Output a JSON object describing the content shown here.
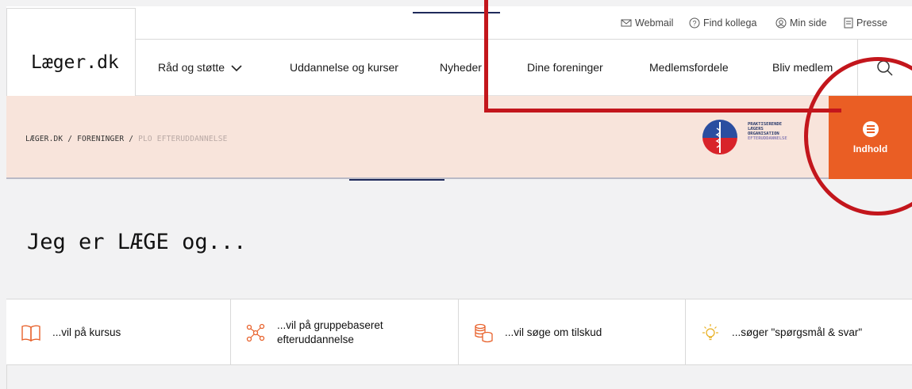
{
  "header": {
    "logo": "Læger.dk",
    "utility": [
      {
        "label": "Webmail",
        "icon": "mail-icon"
      },
      {
        "label": "Find kollega",
        "icon": "question-circle-icon"
      },
      {
        "label": "Min side",
        "icon": "user-circle-icon"
      },
      {
        "label": "Presse",
        "icon": "document-icon"
      }
    ],
    "nav": [
      {
        "label": "Råd og støtte"
      },
      {
        "label": "Uddannelse og kurser"
      },
      {
        "label": "Nyheder"
      },
      {
        "label": "Dine foreninger"
      },
      {
        "label": "Medlemsfordele"
      },
      {
        "label": "Bliv medlem"
      }
    ]
  },
  "breadcrumb": {
    "items": [
      "LÆGER.DK",
      "FORENINGER",
      "PLO EFTERUDDANNELSE"
    ],
    "separator": "/"
  },
  "org_logo": {
    "lines": [
      "PRAKTISERENDE",
      "LÆGERS",
      "ORGANISATION",
      "EFTERUDDANNELSE"
    ]
  },
  "content_button": {
    "label": "Indhold"
  },
  "hero": {
    "title": "Jeg er LÆGE og..."
  },
  "cards": [
    {
      "label": "...vil på kursus",
      "icon": "book-icon"
    },
    {
      "label": "...vil på gruppebaseret efteruddannelse",
      "icon": "network-icon"
    },
    {
      "label": "...vil søge om tilskud",
      "icon": "coins-icon"
    },
    {
      "label": "...søger \"spørgsmål & svar\"",
      "icon": "lightbulb-icon"
    }
  ],
  "colors": {
    "accent": "#ea5e24",
    "band": "#f8e4db",
    "annotation": "#c3161c"
  }
}
